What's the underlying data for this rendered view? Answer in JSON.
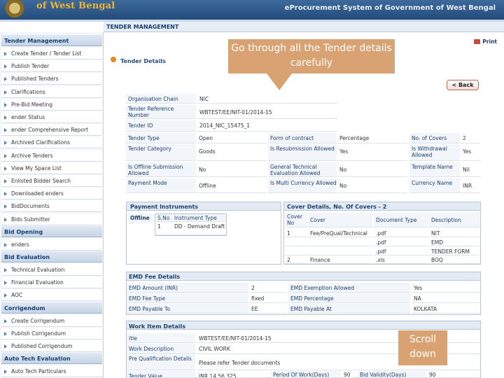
{
  "header": {
    "brand": "of West Bengal",
    "system_title": "eProcurement System of Government of West Bengal"
  },
  "main": {
    "page_title": "TENDER MANAGEMENT",
    "print_label": "Print",
    "section_title": "Tender Details",
    "back_label": "< Back"
  },
  "sidebar": {
    "sections": [
      {
        "title": "Tender Management",
        "items": [
          "Create Tender / Tender List",
          "Publish Tender",
          "Published Tenders",
          "Clarifications",
          "Pre-Bid Meeting",
          "ender Status",
          "ender Comprehensive Report",
          "Archived Clarifications",
          "Archive Tenders",
          "View My Space List",
          "Enlisted Bidder Search",
          "Downloaded enders",
          "BidDocuments",
          "Bids Submitter"
        ]
      },
      {
        "title": "Bid Opening",
        "items": [
          "enders"
        ]
      },
      {
        "title": "Bid Evaluation",
        "items": [
          "Technical Evaluation",
          "Financial Evaluation",
          "AOC"
        ]
      },
      {
        "title": "Corrigendum",
        "items": [
          "Create Corrigendum",
          "Publish Corrigendum",
          "Published Corrigendum"
        ]
      },
      {
        "title": "Auto Tech Evaluation",
        "items": [
          "Auto Tech Particulars"
        ]
      }
    ]
  },
  "tender": {
    "org_chain_label": "Organisation Chain",
    "org_chain_value": "NIC",
    "ref_label": "Tender Reference Number",
    "ref_value": "WBTEST/EE/NIT-01/2014-15",
    "id_label": "Tender ID",
    "id_value": "2014_NIC_15475_1",
    "rows": [
      {
        "l1": "Tender Type",
        "v1": "Open",
        "l2": "Form of contract",
        "v2": "Percentage",
        "l3": "No. of Covers",
        "v3": "2"
      },
      {
        "l1": "Tender Category",
        "v1": "Goods",
        "l2": "Is Resubmission Allowed",
        "v2": "Yes",
        "l3": "Is Withdrawal Allowed",
        "v3": "Yes"
      },
      {
        "l1": "Is Offline Submission Allowed",
        "v1": "No",
        "l2": "General Technical Evaluation Allowed",
        "v2": "No",
        "l3": "Template Name",
        "v3": "Nil"
      },
      {
        "l1": "Payment Mode",
        "v1": "Offline",
        "l2": "Is Multi Currency Allowed",
        "v2": "No",
        "l3": "Currency Name",
        "v3": "INR"
      }
    ]
  },
  "payment": {
    "title": "Payment Instruments",
    "offline_label": "Offline",
    "col_sno": "S.No",
    "col_type": "Instrument Type",
    "rows": [
      {
        "sno": "1",
        "type": "DD - Demand Draft"
      }
    ]
  },
  "covers": {
    "title": "Cover Details, No. Of Covers - 2",
    "col_no": "Cover No",
    "col_cover": "Cover",
    "col_doc": "Document Type",
    "col_desc": "Description",
    "rows": [
      {
        "no": "1",
        "cover": "Fee/PreQual/Technical",
        "doc": ".pdf",
        "desc": "NIT"
      },
      {
        "no": "",
        "cover": "",
        "doc": ".pdf",
        "desc": "EMD"
      },
      {
        "no": "",
        "cover": "",
        "doc": ".pdf",
        "desc": "TENDER FORM"
      },
      {
        "no": "2",
        "cover": "Finance",
        "doc": ".xls",
        "desc": "BOQ"
      }
    ]
  },
  "emd": {
    "title": "EMD Fee Details",
    "rows": [
      {
        "l1": "EMD Amount (INR)",
        "v1": "2",
        "l2": "EMD Exemption Allowed",
        "v2": "Yes"
      },
      {
        "l1": "EMD Fee Type",
        "v1": "fixed",
        "l2": "EMD Percentage",
        "v2": "NA"
      },
      {
        "l1": "EMD Payable To",
        "v1": "EE",
        "l2": "EMD Payable At",
        "v2": "KOLKATA"
      }
    ]
  },
  "work": {
    "title": "Work Item Details",
    "rows": [
      {
        "l": "itle",
        "v": "WBTEST/EE/NIT-01/2014-15"
      },
      {
        "l": "Work Description",
        "v": "CIVIL WORK"
      },
      {
        "l": "Pre Qualification Details",
        "v": "Please refer Tender documents"
      },
      {
        "l": "Tender Value",
        "v": "INR 14,56,325"
      }
    ],
    "period_label": "Period Of Work(Days)",
    "period_value": "90",
    "bid_validity_label": "Bid Validity(Days)",
    "bid_validity_value": "90"
  },
  "callouts": {
    "top": "Go through all the Tender details carefully",
    "bottom": "Scroll down"
  }
}
